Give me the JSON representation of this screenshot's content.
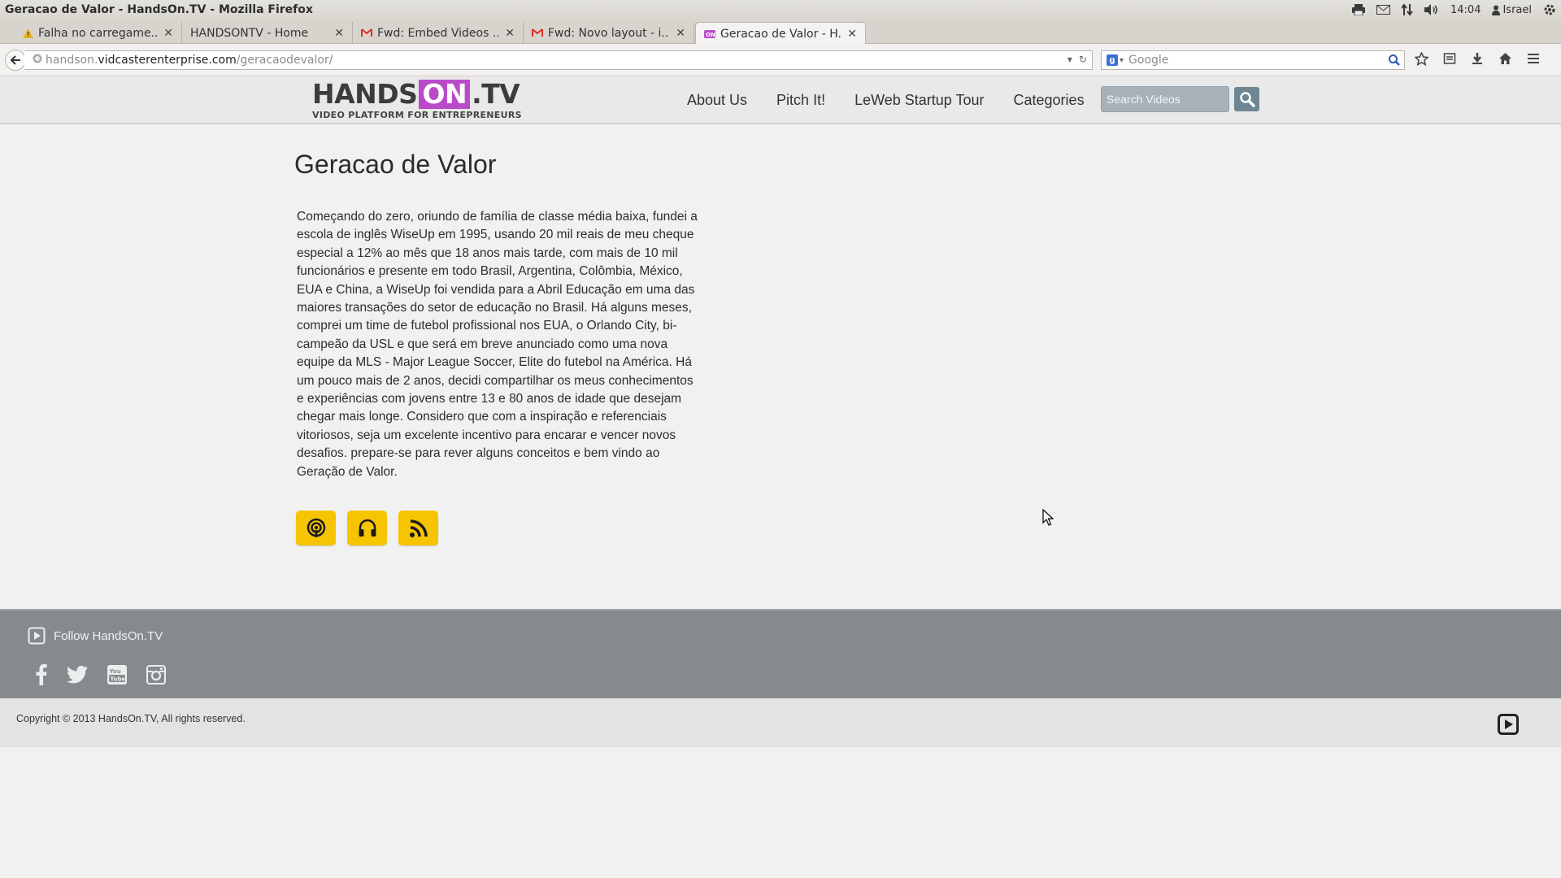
{
  "window": {
    "title": "Geracao de Valor - HandsOn.TV - Mozilla Firefox"
  },
  "system": {
    "time": "14:04",
    "user": "Israel"
  },
  "tabs": [
    {
      "label": "Falha no carregame...",
      "icon": "warning-icon"
    },
    {
      "label": "HANDSONTV - Home",
      "icon": "none"
    },
    {
      "label": "Fwd: Embed Videos ...",
      "icon": "gmail-icon"
    },
    {
      "label": "Fwd: Novo layout - i...",
      "icon": "gmail-icon"
    },
    {
      "label": "Geracao de Valor - H...",
      "icon": "handson-favicon",
      "active": true
    }
  ],
  "urlbar": {
    "prefix": "handson.",
    "domain": "vidcasterenterprise.com",
    "path": "/geracaodevalor/"
  },
  "browser_search": {
    "placeholder": "Google"
  },
  "site": {
    "logo": {
      "hands": "HANDS",
      "on": "ON",
      "tv": ".TV",
      "tagline": "VIDEO PLATFORM FOR ENTREPRENEURS"
    },
    "menu": [
      "About Us",
      "Pitch It!",
      "LeWeb Startup Tour",
      "Categories"
    ],
    "search_placeholder": "Search Videos"
  },
  "content": {
    "title": "Geracao de Valor",
    "description": "Começando do zero, oriundo de família de classe média baixa, fundei a escola de inglês WiseUp em 1995, usando 20 mil reais de meu cheque especial a 12% ao mês que 18 anos mais tarde, com mais de 10 mil funcionários e presente em todo Brasil, Argentina, Colômbia, México, EUA e China, a WiseUp foi vendida para a Abril Educação em uma das maiores transações do setor de educação no Brasil. Há alguns meses, comprei um time de futebol profissional nos EUA, o Orlando City, bi-campeão da USL e que será em breve anunciado como uma nova equipe da MLS - Major League Soccer, Elite do futebol na América. Há um pouco mais de 2 anos, decidi compartilhar os meus conhecimentos e experiências com jovens entre 13 e 80 anos de idade que desejam chegar mais longe. Considero que com a inspiração e referenciais vitoriosos, seja um excelente incentivo para encarar e vencer novos desafios. prepare-se para rever alguns conceitos e bem vindo ao Geração de Valor.",
    "podcast_buttons": [
      "podcast-icon",
      "headphones-icon",
      "rss-icon"
    ],
    "accent_color": "#f6c400"
  },
  "footer": {
    "follow_label": "Follow HandsOn.TV",
    "social": [
      "facebook-icon",
      "twitter-icon",
      "youtube-icon",
      "instagram-icon"
    ],
    "copyright": "Copyright © 2013 HandsOn.TV, All rights reserved."
  }
}
